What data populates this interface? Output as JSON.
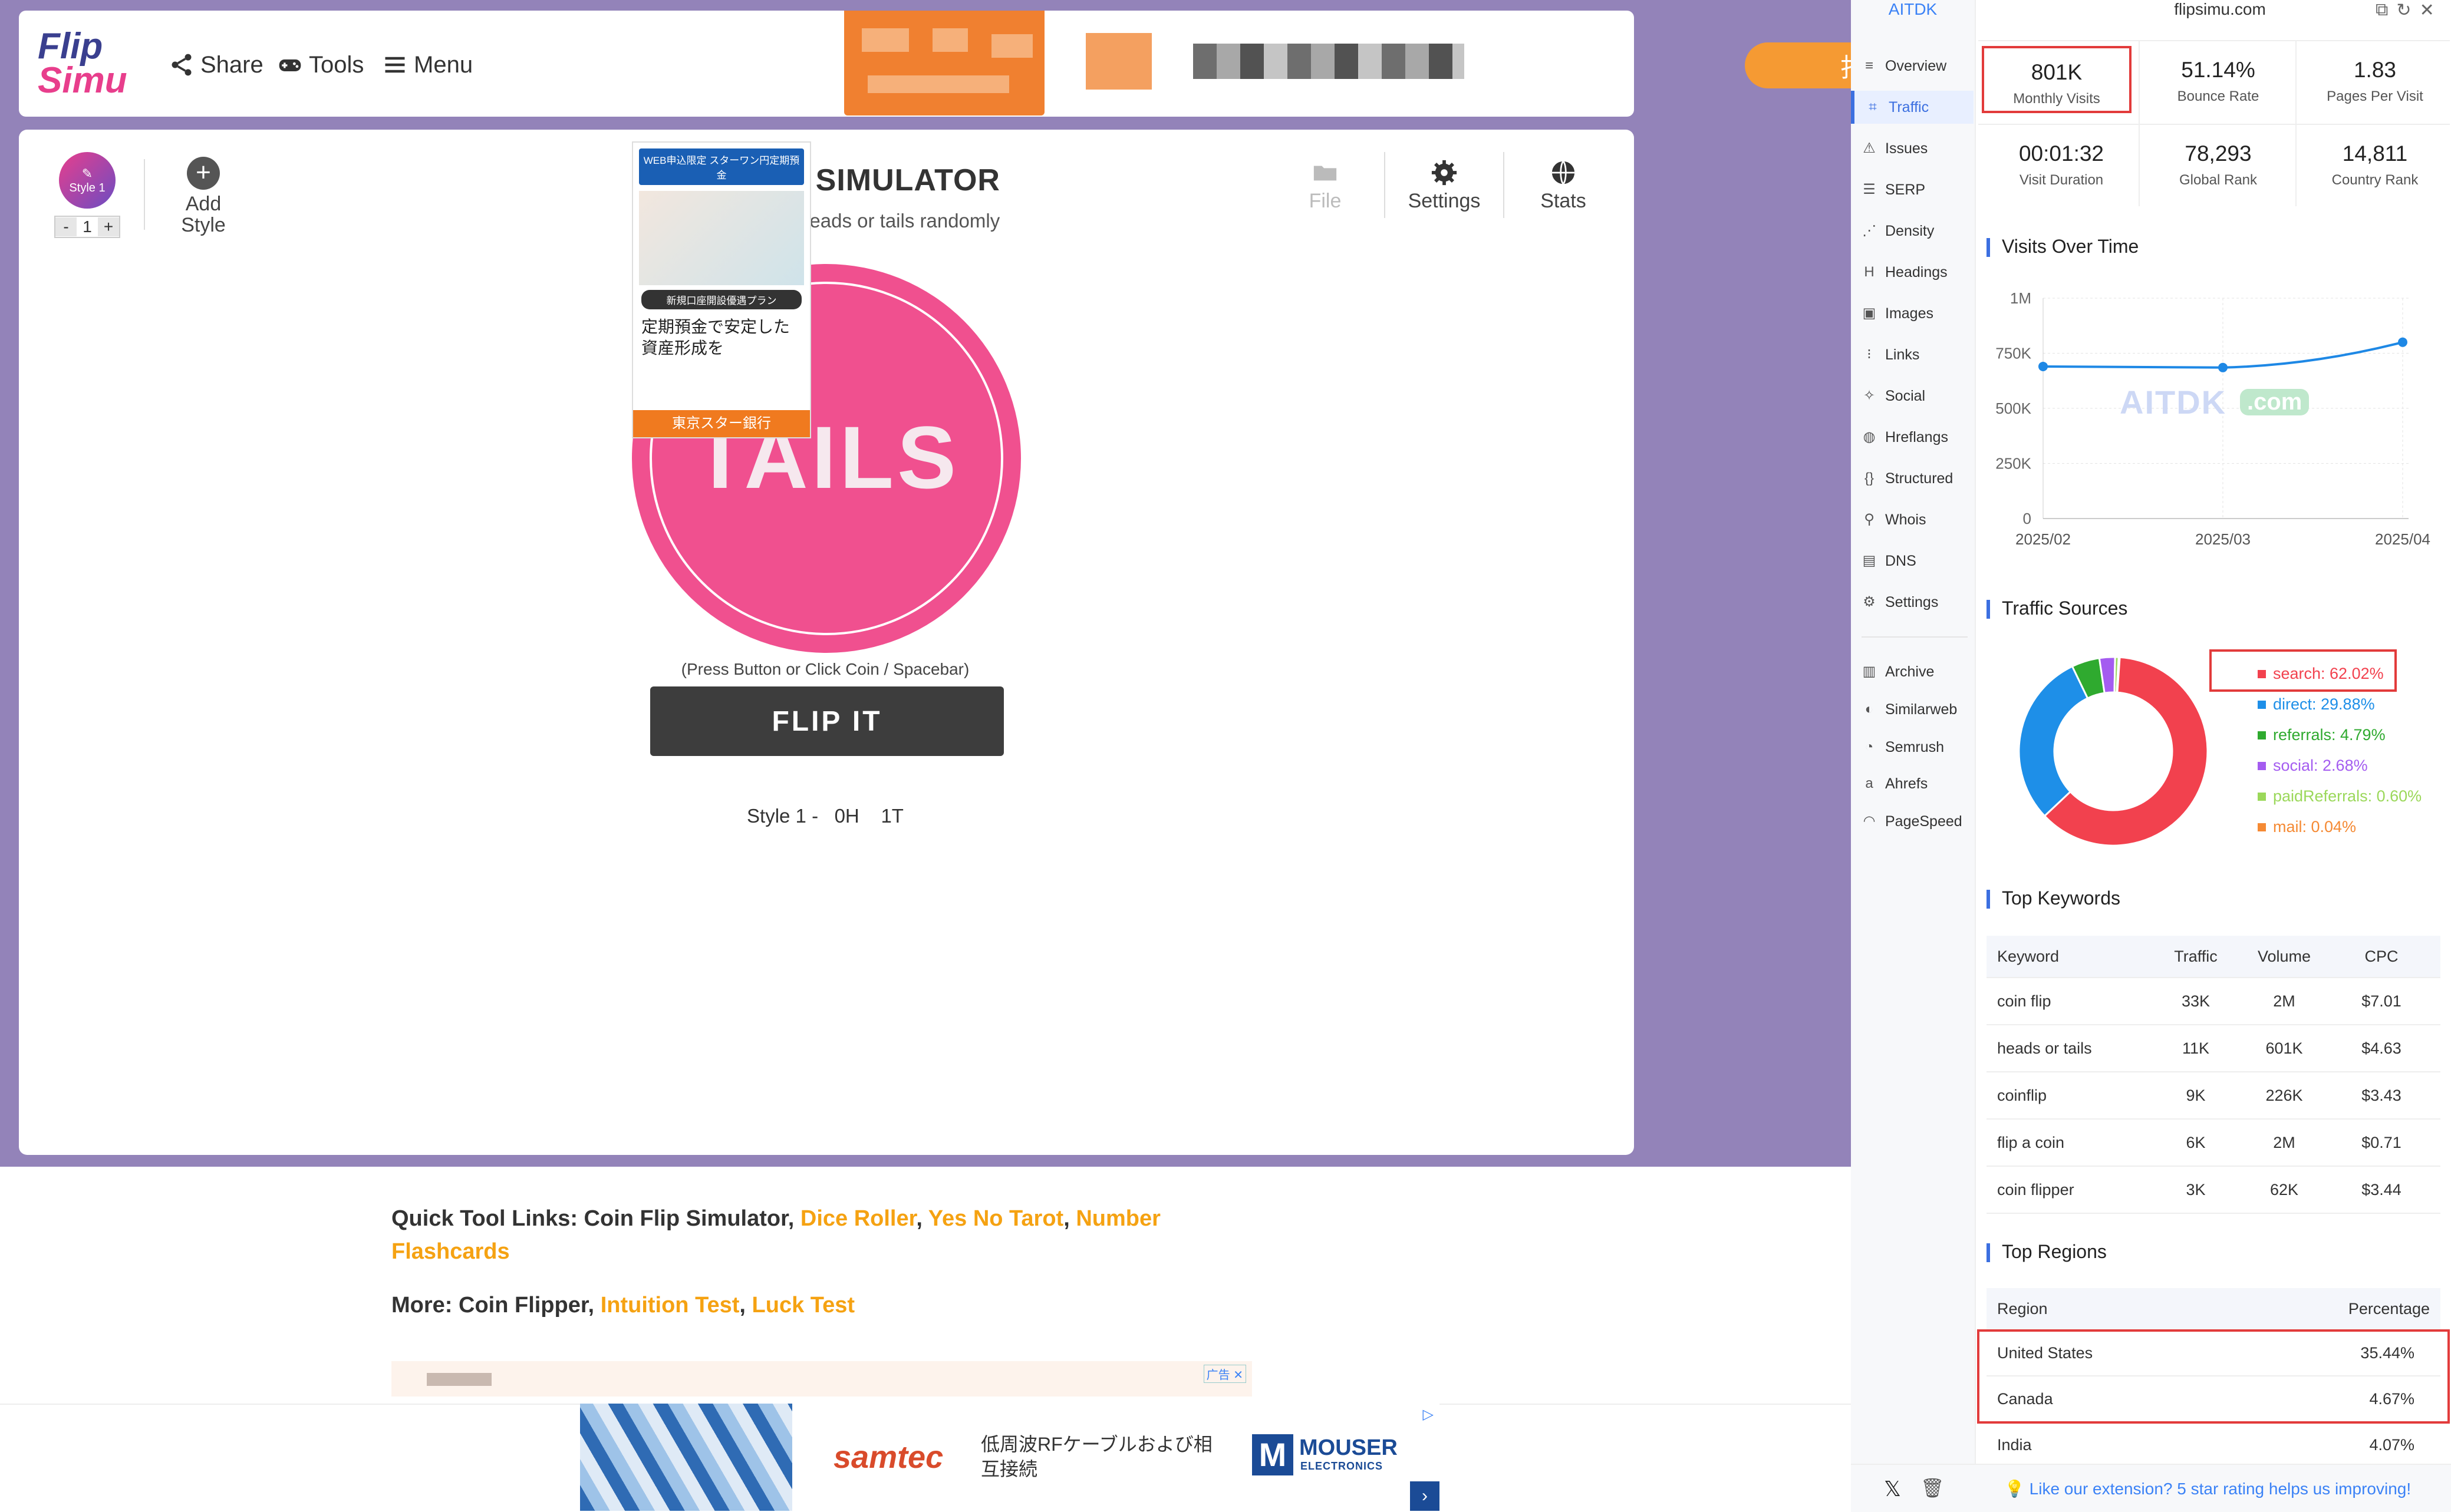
{
  "site": {
    "logo_text_1": "Flip",
    "logo_text_2": "Simu",
    "nav": [
      {
        "label": "Share",
        "icon": "share-icon"
      },
      {
        "label": "Tools",
        "icon": "gamepad-icon"
      },
      {
        "label": "Menu",
        "icon": "hamburger-icon"
      }
    ],
    "orange_button_char": "打",
    "style_badge": "Style 1",
    "stepper_minus": "-",
    "stepper_value": "1",
    "stepper_plus": "+",
    "add_style_label": "Add Style",
    "title": "COIN FLIP SIMULATOR",
    "subtitle": "Flip a coin to get heads or tails randomly",
    "toolbar": {
      "file": "File",
      "settings": "Settings",
      "stats": "Stats"
    },
    "coin_text": "TAILS",
    "press_hint": "(Press Button or Click Coin / Spacebar)",
    "flip_button": "FLIP IT",
    "tally_style": "Style 1 -",
    "tally_heads": "0H",
    "tally_tails": "1T",
    "quick_links_prefix": "Quick Tool Links: Coin Flip Simulator, ",
    "quick_links": [
      "Dice Roller",
      "Yes No Tarot",
      "Number Flashcards"
    ],
    "more_prefix": "More: Coin Flipper, ",
    "more_links": [
      "Intuition Test",
      "Luck Test"
    ],
    "jp_ad": {
      "header": "WEB申込限定 スターワン円定期預金",
      "badge": "新規口座開設優遇プラン",
      "copy": "定期預金で安定した資産形成を",
      "bank": "東京スター銀行"
    },
    "bottom_ad": {
      "brand": "samtec",
      "copy": "低周波RFケーブルおよび相互接続",
      "brand2": "MOUSER",
      "brand2_sub": "ELECTRONICS",
      "ad_label": "广告"
    }
  },
  "extension": {
    "brand": "AITDK",
    "domain": "flipsimu.com",
    "nav": [
      {
        "label": "Overview",
        "icon": "list-icon"
      },
      {
        "label": "Traffic",
        "icon": "chart-icon",
        "active": true
      },
      {
        "label": "Issues",
        "icon": "warning-icon"
      },
      {
        "label": "SERP",
        "icon": "serp-icon"
      },
      {
        "label": "Density",
        "icon": "density-icon"
      },
      {
        "label": "Headings",
        "icon": "heading-icon"
      },
      {
        "label": "Images",
        "icon": "image-icon"
      },
      {
        "label": "Links",
        "icon": "links-icon"
      },
      {
        "label": "Social",
        "icon": "twitter-icon"
      },
      {
        "label": "Hreflangs",
        "icon": "globe-icon"
      },
      {
        "label": "Structured",
        "icon": "braces-icon"
      },
      {
        "label": "Whois",
        "icon": "user-search-icon"
      },
      {
        "label": "DNS",
        "icon": "server-icon"
      },
      {
        "label": "Settings",
        "icon": "gear-icon"
      }
    ],
    "tools": [
      {
        "label": "Archive",
        "icon": "archive-icon"
      },
      {
        "label": "Similarweb",
        "icon": "similarweb-icon"
      },
      {
        "label": "Semrush",
        "icon": "semrush-icon"
      },
      {
        "label": "Ahrefs",
        "icon": "ahrefs-icon"
      },
      {
        "label": "PageSpeed",
        "icon": "pagespeed-icon"
      }
    ],
    "stats": [
      {
        "value": "801K",
        "label": "Monthly Visits"
      },
      {
        "value": "51.14%",
        "label": "Bounce Rate"
      },
      {
        "value": "1.83",
        "label": "Pages Per Visit"
      },
      {
        "value": "00:01:32",
        "label": "Visit Duration"
      },
      {
        "value": "78,293",
        "label": "Global Rank"
      },
      {
        "value": "14,811",
        "label": "Country Rank"
      }
    ],
    "visits_title": "Visits Over Time",
    "watermark": "AITDK",
    "watermark_com": ".com",
    "traffic_title": "Traffic Sources",
    "keywords_title": "Top Keywords",
    "keywords_headers": [
      "Keyword",
      "Traffic",
      "Volume",
      "CPC"
    ],
    "keywords": [
      [
        "coin flip",
        "33K",
        "2M",
        "$7.01"
      ],
      [
        "heads or tails",
        "11K",
        "601K",
        "$4.63"
      ],
      [
        "coinflip",
        "9K",
        "226K",
        "$3.43"
      ],
      [
        "flip a coin",
        "6K",
        "2M",
        "$0.71"
      ],
      [
        "coin flipper",
        "3K",
        "62K",
        "$3.44"
      ]
    ],
    "regions_title": "Top Regions",
    "regions_headers": [
      "Region",
      "Percentage"
    ],
    "regions": [
      [
        "United States",
        "35.44%"
      ],
      [
        "Canada",
        "4.67%"
      ],
      [
        "India",
        "4.07%"
      ]
    ],
    "footer_text": "Like our extension? 5 star rating helps us improving!"
  },
  "chart_data": [
    {
      "type": "line",
      "x": [
        "2025/02",
        "2025/03",
        "2025/04"
      ],
      "series": [
        {
          "values": [
            690000,
            685000,
            800000
          ]
        }
      ],
      "ylim": [
        0,
        1000000
      ],
      "yticks": [
        "0",
        "250K",
        "500K",
        "750K",
        "1M"
      ],
      "color": "#1e88e5"
    },
    {
      "type": "pie",
      "donut": true,
      "slices": [
        {
          "label": "search: 62.02%",
          "value": 62.02,
          "color": "#f2414e"
        },
        {
          "label": "direct: 29.88%",
          "value": 29.88,
          "color": "#1e8fe8"
        },
        {
          "label": "referrals: 4.79%",
          "value": 4.79,
          "color": "#2faa2f"
        },
        {
          "label": "social: 2.68%",
          "value": 2.68,
          "color": "#a45cf0"
        },
        {
          "label": "paidReferrals: 0.60%",
          "value": 0.6,
          "color": "#9bd85a"
        },
        {
          "label": "mail: 0.04%",
          "value": 0.04,
          "color": "#f58a34"
        }
      ]
    }
  ]
}
